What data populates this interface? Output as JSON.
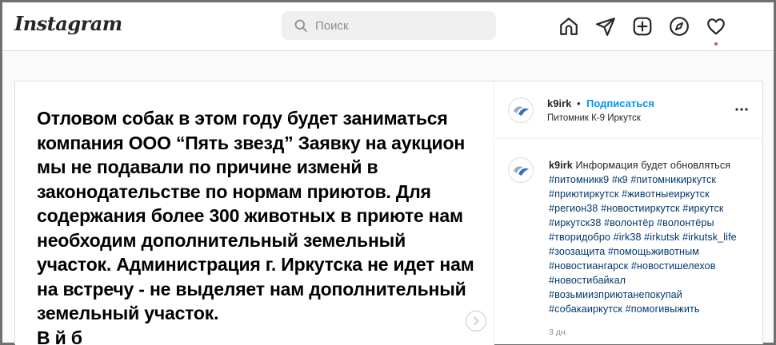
{
  "header": {
    "logo": "Instagram",
    "search_placeholder": "Поиск",
    "nav_icons": [
      "home-icon",
      "direct-message-icon",
      "new-post-icon",
      "explore-icon",
      "activity-heart-icon"
    ],
    "notification_dot_color": "#ed4956"
  },
  "post": {
    "image_text": "Отловом собак в этом году будет заниматься компания ООО “Пять звезд” Заявку на аукцион мы не подавали по причине изменй в законодательстве по нормам приютов. Для содержания более 300 животных в приюте нам необходим дополнительный земельный участок. Администрация г. Иркутска не идет нам на встречу - не выделяет нам дополнительный земельный участок.",
    "image_text_cut_line": "В                    й         б",
    "author": {
      "username": "k9irk",
      "separator": "•",
      "follow_label": "Подписаться",
      "location": "Питомник К-9 Иркутск"
    },
    "caption": {
      "username": "k9irk",
      "text": "Информация будет обновляться",
      "hashtags": [
        "#питомникк9",
        "#к9",
        "#питомникиркутск",
        "#приютиркутск",
        "#животныеиркутск",
        "#регион38",
        "#новостииркутск",
        "#иркутск",
        "#иркутск38",
        "#волонтёр",
        "#волонтёры",
        "#творидобро",
        "#irk38",
        "#irkutsk",
        "#irkutsk_life",
        "#зоозащита",
        "#помощьживотным",
        "#новостиангарск",
        "#новостишелехов",
        "#новостибайкал",
        "#возьмиизприютанепокупай",
        "#собакаиркутск",
        "#помогивыжить"
      ],
      "time": "3 дн."
    },
    "accent_color": "#0095f6",
    "hashtag_color": "#00376b"
  }
}
